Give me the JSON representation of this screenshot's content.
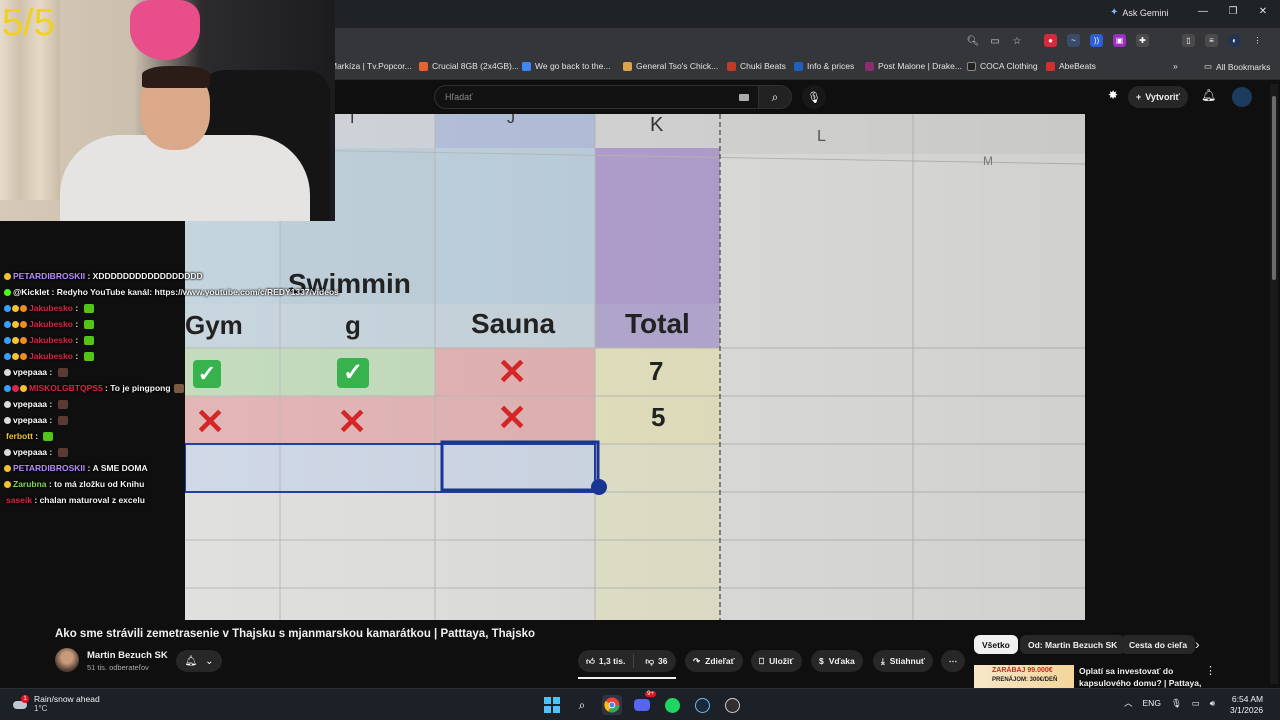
{
  "overlay": {
    "score": "5/5"
  },
  "browser": {
    "ask_gemini": "Ask Gemini",
    "bookmarks": [
      {
        "label": "Markíza | Tv.Popcor...",
        "color": "#2f6fe0"
      },
      {
        "label": "Crucial 8GB (2x4GB)...",
        "color": "#e8642c"
      },
      {
        "label": "We go back to the...",
        "color": "#4285f4"
      },
      {
        "label": "General Tso's Chick...",
        "color": "#d9a44b"
      },
      {
        "label": "Chuki Beats",
        "color": "#c0392b"
      },
      {
        "label": "Info & prices",
        "color": "#1f5fbf"
      },
      {
        "label": "Post Malone | Drake...",
        "color": "#8e2d6b"
      },
      {
        "label": "COCA Clothing",
        "color": "#222222"
      },
      {
        "label": "AbeBeats",
        "color": "#d32f2f"
      }
    ],
    "all_bookmarks": "All Bookmarks"
  },
  "youtube": {
    "search_placeholder": "Hľadať",
    "create_label": "Vytvoriť"
  },
  "chat": [
    {
      "user": "PETARDIBROSKII",
      "user_color": "#b58cff",
      "message": "XDDDDDDDDDDDDDDDDD",
      "badges": [
        "#f2c230"
      ],
      "emote": ""
    },
    {
      "user": "@Kicklet",
      "user_color": "#ffffff",
      "message": "Redyho YouTube kanál: https://www.youtube.com/c/REDY1337/videos",
      "badges": [
        "#53fc18"
      ],
      "emote": ""
    },
    {
      "user": "Jakubesko",
      "user_color": "#e0244a",
      "message": "",
      "badges": [
        "#3aa0ff",
        "#f2c230",
        "#f28c28"
      ],
      "emote": "#53c418"
    },
    {
      "user": "Jakubesko",
      "user_color": "#e0244a",
      "message": "",
      "badges": [
        "#3aa0ff",
        "#f2c230",
        "#f28c28"
      ],
      "emote": "#53c418"
    },
    {
      "user": "Jakubesko",
      "user_color": "#e0244a",
      "message": "",
      "badges": [
        "#3aa0ff",
        "#f2c230",
        "#f28c28"
      ],
      "emote": "#53c418"
    },
    {
      "user": "Jakubesko",
      "user_color": "#e0244a",
      "message": "",
      "badges": [
        "#3aa0ff",
        "#f2c230",
        "#f28c28"
      ],
      "emote": "#53c418"
    },
    {
      "user": "vpepaaa",
      "user_color": "#ffffff",
      "message": "",
      "badges": [
        "#dddddd"
      ],
      "emote": "#5a3b30"
    },
    {
      "user": "MISKOLGBTQPS5",
      "user_color": "#e0244a",
      "message": "To je pingpong",
      "badges": [
        "#3aa0ff",
        "#e0244a",
        "#f2c230"
      ],
      "emote": "#7a5a40"
    },
    {
      "user": "vpepaaa",
      "user_color": "#ffffff",
      "message": "",
      "badges": [
        "#dddddd"
      ],
      "emote": "#5a3b30"
    },
    {
      "user": "vpepaaa",
      "user_color": "#ffffff",
      "message": "",
      "badges": [
        "#dddddd"
      ],
      "emote": "#5a3b30"
    },
    {
      "user": "ferbott",
      "user_color": "#f2c230",
      "message": "",
      "badges": [],
      "emote": "#53c418"
    },
    {
      "user": "vpepaaa",
      "user_color": "#ffffff",
      "message": "",
      "badges": [
        "#dddddd"
      ],
      "emote": "#5a3b30"
    },
    {
      "user": "PETARDIBROSKII",
      "user_color": "#b58cff",
      "message": "A SME DOMA",
      "badges": [
        "#f2c230"
      ],
      "emote": ""
    },
    {
      "user": "Zarubna",
      "user_color": "#7cd957",
      "message": "to má zložku od Knihu",
      "badges": [
        "#f2c230"
      ],
      "emote": ""
    },
    {
      "user": "saseik",
      "user_color": "#e0244a",
      "message": "chalan maturoval z excelu",
      "badges": [],
      "emote": ""
    }
  ],
  "spreadsheet": {
    "columns": [
      "I",
      "J",
      "K",
      "L",
      "M"
    ],
    "headers": [
      "Gym",
      "Swimmin",
      "g",
      "Sauna",
      "Total"
    ],
    "rows": [
      {
        "gym": "check",
        "swimming": "check",
        "sauna": "cross",
        "total": "7"
      },
      {
        "gym": "cross",
        "swimming": "cross",
        "sauna": "cross",
        "total": "5"
      }
    ],
    "check_glyph": "✓",
    "cross_glyph": "✕"
  },
  "video": {
    "title": "Ako sme strávili zemetrasenie v Thajsku s mjanmarskou kamarátkou | Patttaya, Thajsko",
    "channel": "Martin Bezuch SK",
    "subscribers": "51 tis. odberateľov",
    "likes": "1,3 tis.",
    "dislikes": "36",
    "share": "Zdieľať",
    "save": "Uložiť",
    "thanks": "Vďaka",
    "download": "Stiahnuť"
  },
  "recommendations": {
    "chips": [
      "Všetko",
      "Od: Martin Bezuch SK",
      "Cesta do cieľa"
    ],
    "thumb_text": "ZARÁBAJ 99.000€",
    "thumb_sub": "PRENÁJOM: 300€/DEŇ",
    "item_title": "Oplatí sa investovať do kapsulového domu? | Pattaya, ..."
  },
  "taskbar": {
    "weather_title": "Rain/snow ahead",
    "weather_temp": "1°C",
    "weather_badge": "1",
    "language": "ENG",
    "time": "6:54 AM",
    "date": "3/1/2026",
    "discord_badge": "9+"
  }
}
